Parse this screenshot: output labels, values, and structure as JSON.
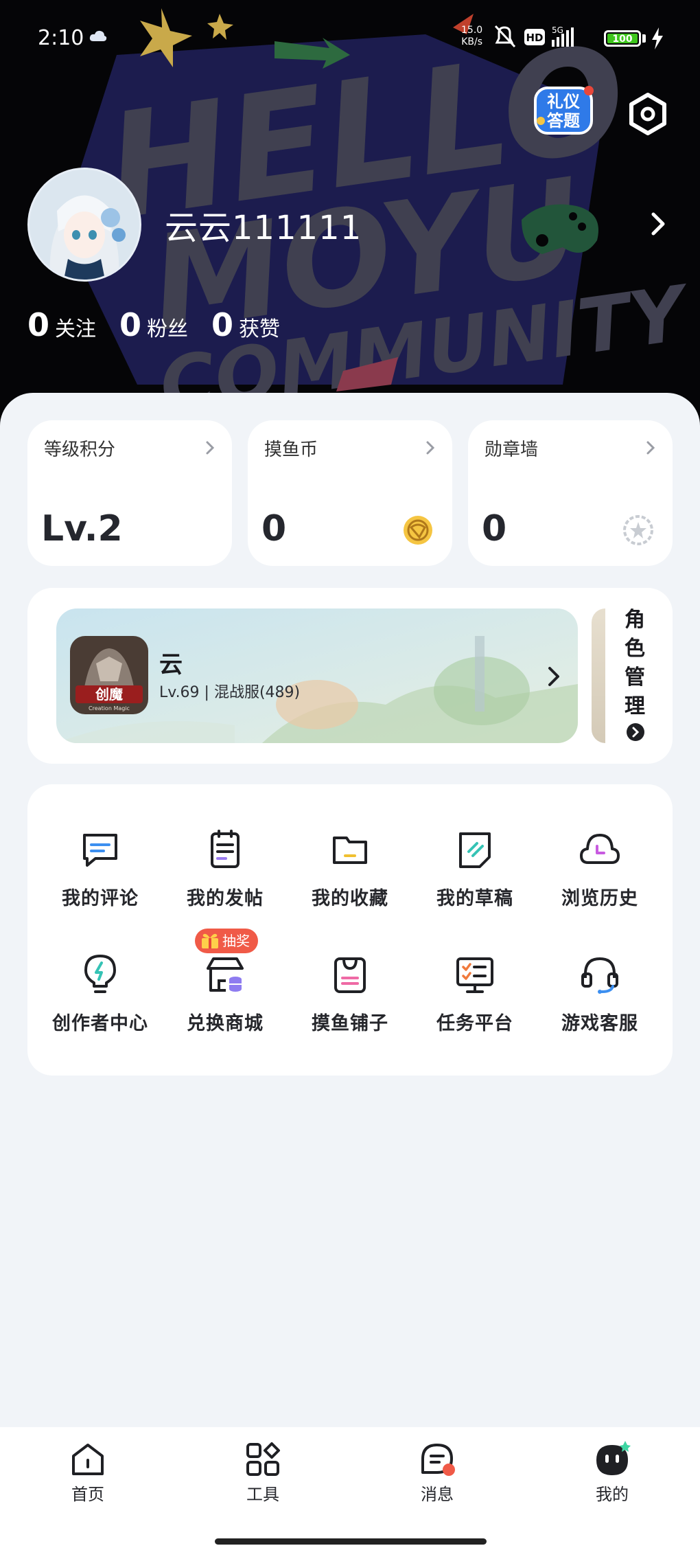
{
  "status_bar": {
    "time": "2:10",
    "net_speed": "15.0",
    "net_unit": "KB/s",
    "network": "5G",
    "hd": "HD",
    "battery": "100"
  },
  "header": {
    "background_text": [
      "HELLO",
      "MOYU",
      "COMMUNITY"
    ],
    "etiquette_badge": [
      "礼仪",
      "答题"
    ],
    "username": "云云111111",
    "stats": [
      {
        "value": "0",
        "label": "关注"
      },
      {
        "value": "0",
        "label": "粉丝"
      },
      {
        "value": "0",
        "label": "获赞"
      }
    ]
  },
  "summary_cards": [
    {
      "title": "等级积分",
      "value": "Lv.2",
      "icon": "chevron-right-icon"
    },
    {
      "title": "摸鱼币",
      "value": "0",
      "icon": "coin-icon"
    },
    {
      "title": "勋章墙",
      "value": "0",
      "icon": "medal-icon"
    }
  ],
  "role_card": {
    "role_name": "云",
    "role_info": "Lv.69 | 混战服(489)",
    "game_logo_text": "创魔",
    "game_logo_sub": "Creation Magic",
    "manage_label": "角色管理"
  },
  "menu": [
    {
      "label": "我的评论",
      "icon": "comment-icon"
    },
    {
      "label": "我的发帖",
      "icon": "post-icon"
    },
    {
      "label": "我的收藏",
      "icon": "folder-icon"
    },
    {
      "label": "我的草稿",
      "icon": "draft-icon"
    },
    {
      "label": "浏览历史",
      "icon": "history-cloud-icon"
    },
    {
      "label": "创作者中心",
      "icon": "bulb-icon"
    },
    {
      "label": "兑换商城",
      "icon": "shop-icon"
    },
    {
      "label": "摸鱼铺子",
      "icon": "bag-icon"
    },
    {
      "label": "任务平台",
      "icon": "task-board-icon"
    },
    {
      "label": "游戏客服",
      "icon": "headset-icon"
    }
  ],
  "lottery_badge": "抽奖",
  "tabs": [
    {
      "label": "首页",
      "icon": "home-icon"
    },
    {
      "label": "工具",
      "icon": "tools-icon"
    },
    {
      "label": "消息",
      "icon": "message-icon"
    },
    {
      "label": "我的",
      "icon": "mine-icon"
    }
  ],
  "colors": {
    "header_bg": "#050507",
    "page_bg": "#f1f4f8",
    "accent_red": "#f05a47",
    "coin": "#f5c542"
  }
}
